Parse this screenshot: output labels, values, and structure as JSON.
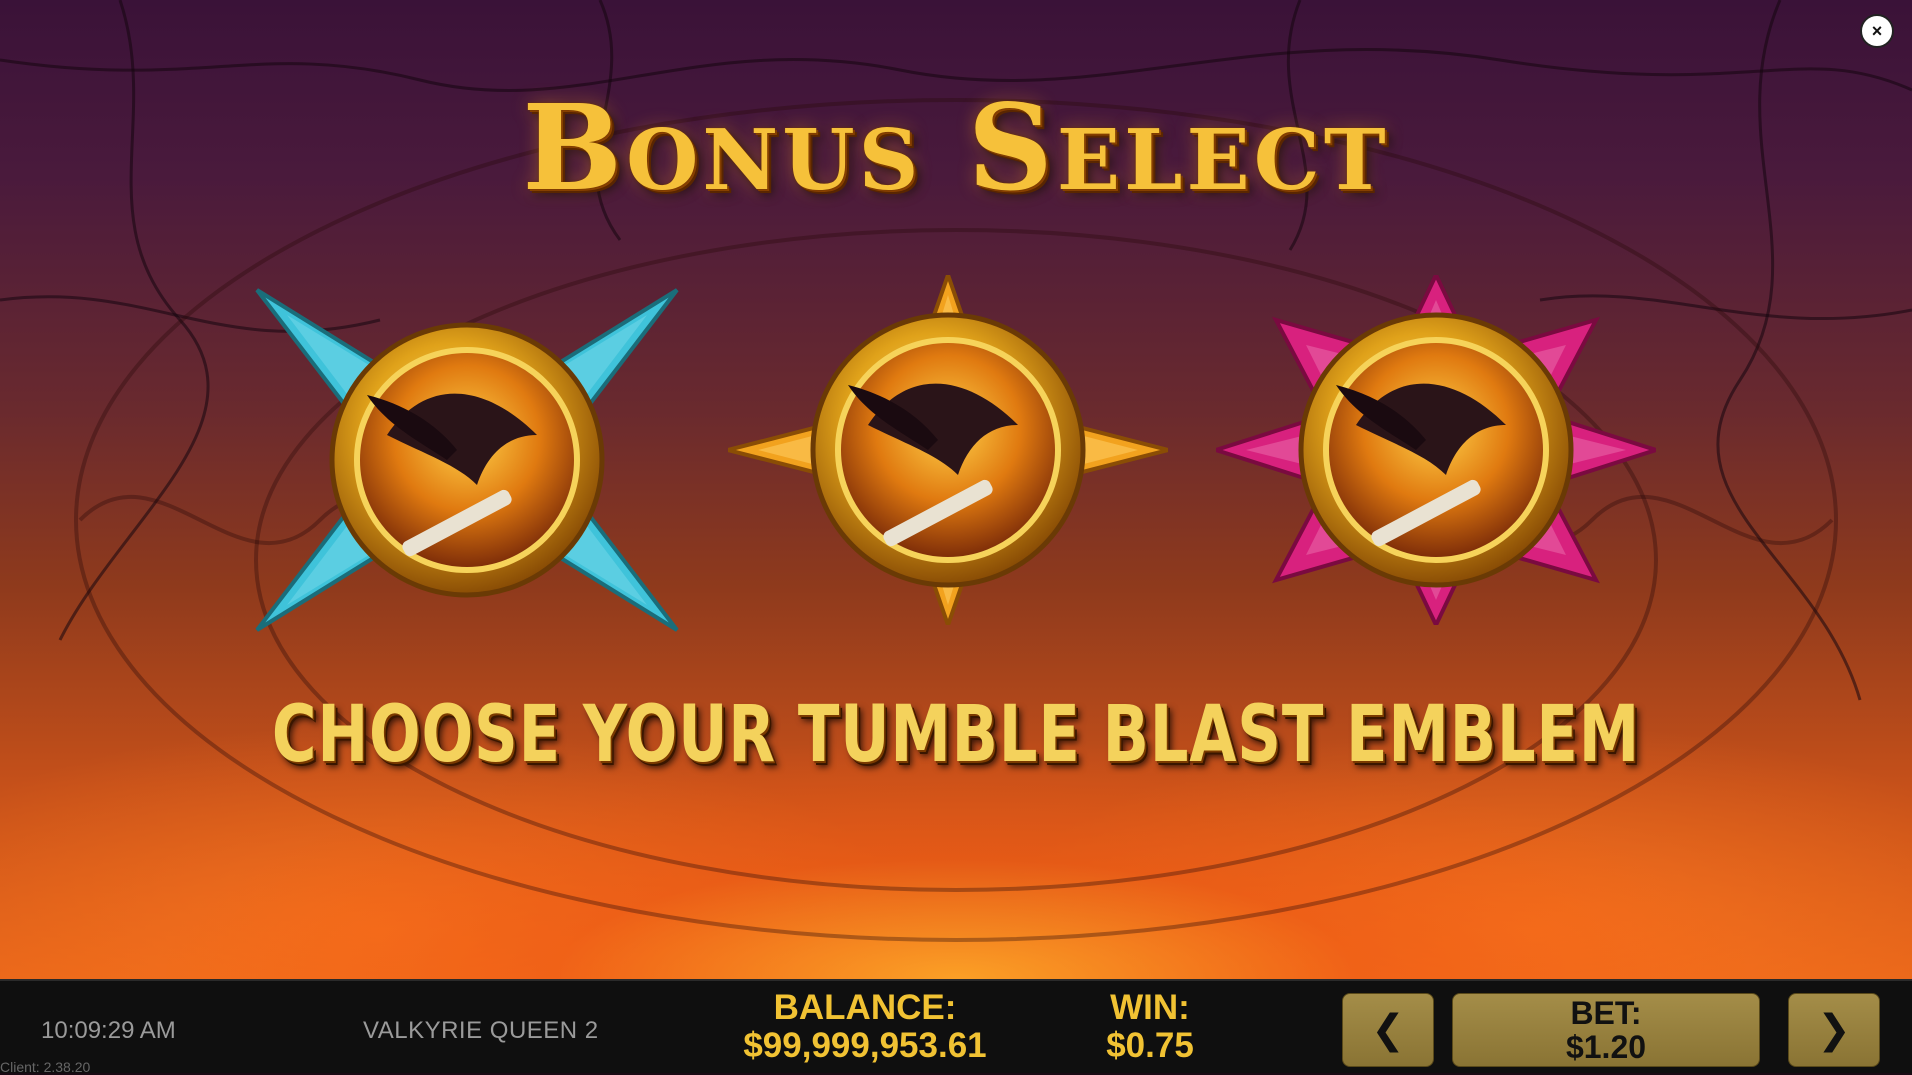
{
  "game": {
    "title": "Bonus Select",
    "subtitle": "CHOOSE YOUR TUMBLE BLAST EMBLEM",
    "emblems": [
      {
        "name": "cyan-emblem",
        "accent": "#3fc3da"
      },
      {
        "name": "gold-emblem",
        "accent": "#f2a21e"
      },
      {
        "name": "magenta-emblem",
        "accent": "#d8217e"
      }
    ]
  },
  "controls": {
    "close_icon": "×",
    "prev_icon": "❮",
    "next_icon": "❯"
  },
  "footer": {
    "time": "10:09:29 AM",
    "client": "Client: 2.38.20",
    "game_name": "VALKYRIE QUEEN 2",
    "balance_label": "BALANCE:",
    "balance_value": "$99,999,953.61",
    "win_label": "WIN:",
    "win_value": "$0.75",
    "bet_label": "BET:",
    "bet_value": "$1.20"
  },
  "colors": {
    "gold_text": "#f1c233",
    "button_gold": "#a48d48",
    "footer_bg": "#0f0f0f"
  }
}
